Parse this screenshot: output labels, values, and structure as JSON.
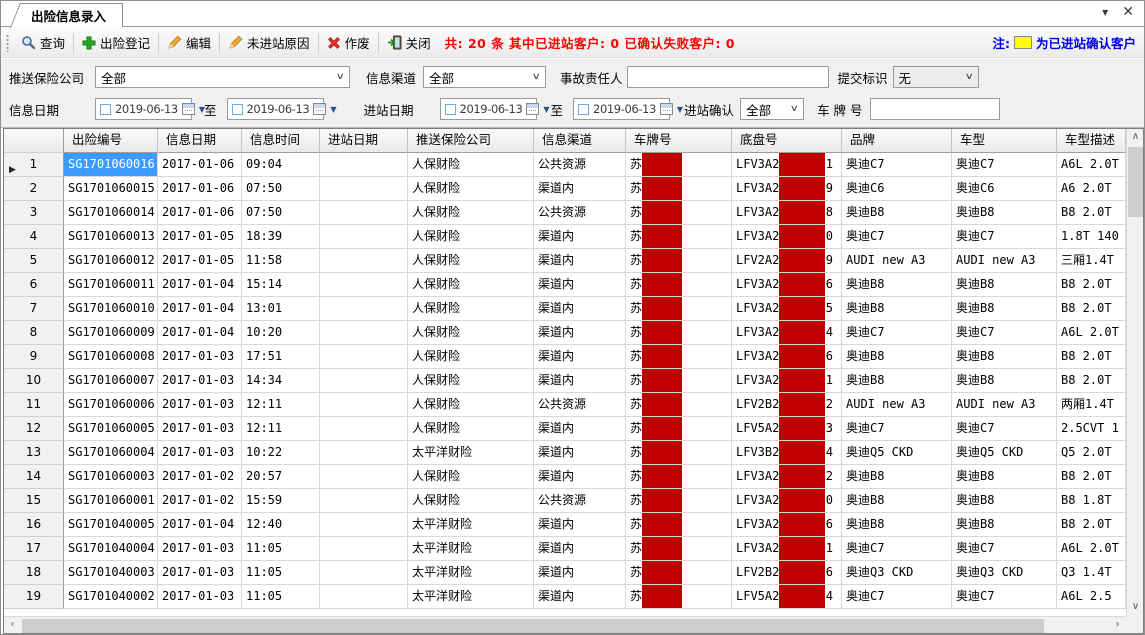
{
  "window": {
    "tab_title": "出险信息录入",
    "dropdown_glyph": "▼",
    "close_glyph": "✕"
  },
  "toolbar": {
    "buttons": [
      {
        "name": "query-button",
        "icon": "search-icon",
        "label": "查询"
      },
      {
        "name": "claim-register-button",
        "icon": "plus-icon",
        "label": "出险登记"
      },
      {
        "name": "edit-button",
        "icon": "pencil-icon",
        "label": "编辑"
      },
      {
        "name": "no-entry-reason-button",
        "icon": "pencil-icon",
        "label": "未进站原因"
      },
      {
        "name": "void-button",
        "icon": "void-x-icon",
        "label": "作废"
      },
      {
        "name": "close-button",
        "icon": "close-exit-icon",
        "label": "关闭"
      }
    ],
    "summary": "共:  20 条  其中已进站客户: 0  已确认失败客户: 0",
    "note_prefix": "注:",
    "note_swatch_color": "#ffff00",
    "note_suffix": "为已进站确认客户"
  },
  "filters": {
    "insurer_label": "推送保险公司",
    "insurer_value": "全部",
    "channel_label": "信息渠道",
    "channel_value": "全部",
    "responsible_label": "事故责任人",
    "responsible_value": "",
    "submit_flag_label": "提交标识",
    "submit_flag_value": "无",
    "info_date_label": "信息日期",
    "info_date_from": "2019-06-13",
    "to_label_1": "至",
    "info_date_to": "2019-06-13",
    "station_date_label": "进站日期",
    "station_date_from": "2019-06-13",
    "to_label_2": "至",
    "station_date_to": "2019-06-13",
    "station_confirm_label": "进站确认",
    "station_confirm_value": "全部",
    "plate_label": "车 牌 号",
    "plate_value": ""
  },
  "grid": {
    "columns": [
      "出险编号",
      "信息日期",
      "信息时间",
      "进站日期",
      "推送保险公司",
      "信息渠道",
      "车牌号",
      "底盘号",
      "品牌",
      "车型",
      "车型描述"
    ],
    "redaction_color": "#c00000",
    "selection_color": "#3d9bff",
    "rows": [
      {
        "num": "1",
        "claim_no": "SG1701060016",
        "info_date": "2017-01-06",
        "info_time": "09:04",
        "station_date": "",
        "insurer": "人保财险",
        "channel": "公共资源",
        "plate_prefix": "苏",
        "chassis_prefix": "LFV3A2",
        "chassis_suffix": "1",
        "brand": "奥迪C7",
        "model": "奥迪C7",
        "desc": "A6L 2.0T",
        "selected": true
      },
      {
        "num": "2",
        "claim_no": "SG1701060015",
        "info_date": "2017-01-06",
        "info_time": "07:50",
        "station_date": "",
        "insurer": "人保财险",
        "channel": "渠道内",
        "plate_prefix": "苏",
        "chassis_prefix": "LFV3A2",
        "chassis_suffix": "9",
        "brand": "奥迪C6",
        "model": "奥迪C6",
        "desc": "A6 2.0T",
        "selected": false
      },
      {
        "num": "3",
        "claim_no": "SG1701060014",
        "info_date": "2017-01-06",
        "info_time": "07:50",
        "station_date": "",
        "insurer": "人保财险",
        "channel": "公共资源",
        "plate_prefix": "苏",
        "chassis_prefix": "LFV3A2",
        "chassis_suffix": "8",
        "brand": "奥迪B8",
        "model": "奥迪B8",
        "desc": "B8 2.0T",
        "selected": false
      },
      {
        "num": "4",
        "claim_no": "SG1701060013",
        "info_date": "2017-01-05",
        "info_time": "18:39",
        "station_date": "",
        "insurer": "人保财险",
        "channel": "渠道内",
        "plate_prefix": "苏",
        "chassis_prefix": "LFV3A2",
        "chassis_suffix": "0",
        "brand": "奥迪C7",
        "model": "奥迪C7",
        "desc": "1.8T 140",
        "selected": false
      },
      {
        "num": "5",
        "claim_no": "SG1701060012",
        "info_date": "2017-01-05",
        "info_time": "11:58",
        "station_date": "",
        "insurer": "人保财险",
        "channel": "渠道内",
        "plate_prefix": "苏",
        "chassis_prefix": "LFV2A2",
        "chassis_suffix": "9",
        "brand": "AUDI new A3",
        "model": "AUDI new A3",
        "desc": "三厢1.4T",
        "selected": false
      },
      {
        "num": "6",
        "claim_no": "SG1701060011",
        "info_date": "2017-01-04",
        "info_time": "15:14",
        "station_date": "",
        "insurer": "人保财险",
        "channel": "渠道内",
        "plate_prefix": "苏",
        "chassis_prefix": "LFV3A2",
        "chassis_suffix": "6",
        "brand": "奥迪B8",
        "model": "奥迪B8",
        "desc": "B8 2.0T",
        "selected": false
      },
      {
        "num": "7",
        "claim_no": "SG1701060010",
        "info_date": "2017-01-04",
        "info_time": "13:01",
        "station_date": "",
        "insurer": "人保财险",
        "channel": "渠道内",
        "plate_prefix": "苏",
        "chassis_prefix": "LFV3A2",
        "chassis_suffix": "5",
        "brand": "奥迪B8",
        "model": "奥迪B8",
        "desc": "B8 2.0T",
        "selected": false
      },
      {
        "num": "8",
        "claim_no": "SG1701060009",
        "info_date": "2017-01-04",
        "info_time": "10:20",
        "station_date": "",
        "insurer": "人保财险",
        "channel": "渠道内",
        "plate_prefix": "苏",
        "chassis_prefix": "LFV3A2",
        "chassis_suffix": "4",
        "brand": "奥迪C7",
        "model": "奥迪C7",
        "desc": "A6L 2.0T",
        "selected": false
      },
      {
        "num": "9",
        "claim_no": "SG1701060008",
        "info_date": "2017-01-03",
        "info_time": "17:51",
        "station_date": "",
        "insurer": "人保财险",
        "channel": "渠道内",
        "plate_prefix": "苏",
        "chassis_prefix": "LFV3A2",
        "chassis_suffix": "6",
        "brand": "奥迪B8",
        "model": "奥迪B8",
        "desc": "B8 2.0T",
        "selected": false
      },
      {
        "num": "10",
        "claim_no": "SG1701060007",
        "info_date": "2017-01-03",
        "info_time": "14:34",
        "station_date": "",
        "insurer": "人保财险",
        "channel": "渠道内",
        "plate_prefix": "苏",
        "chassis_prefix": "LFV3A2",
        "chassis_suffix": "1",
        "brand": "奥迪B8",
        "model": "奥迪B8",
        "desc": "B8 2.0T",
        "selected": false
      },
      {
        "num": "11",
        "claim_no": "SG1701060006",
        "info_date": "2017-01-03",
        "info_time": "12:11",
        "station_date": "",
        "insurer": "人保财险",
        "channel": "公共资源",
        "plate_prefix": "苏",
        "chassis_prefix": "LFV2B2",
        "chassis_suffix": "2",
        "brand": "AUDI new A3",
        "model": "AUDI new A3",
        "desc": "两厢1.4T",
        "selected": false
      },
      {
        "num": "12",
        "claim_no": "SG1701060005",
        "info_date": "2017-01-03",
        "info_time": "12:11",
        "station_date": "",
        "insurer": "人保财险",
        "channel": "渠道内",
        "plate_prefix": "苏",
        "chassis_prefix": "LFV5A2",
        "chassis_suffix": "3",
        "brand": "奥迪C7",
        "model": "奥迪C7",
        "desc": "2.5CVT 1",
        "selected": false
      },
      {
        "num": "13",
        "claim_no": "SG1701060004",
        "info_date": "2017-01-03",
        "info_time": "10:22",
        "station_date": "",
        "insurer": "太平洋财险",
        "channel": "渠道内",
        "plate_prefix": "苏",
        "chassis_prefix": "LFV3B2",
        "chassis_suffix": "4",
        "brand": "奥迪Q5 CKD",
        "model": "奥迪Q5 CKD",
        "desc": "Q5 2.0T",
        "selected": false
      },
      {
        "num": "14",
        "claim_no": "SG1701060003",
        "info_date": "2017-01-02",
        "info_time": "20:57",
        "station_date": "",
        "insurer": "人保财险",
        "channel": "渠道内",
        "plate_prefix": "苏",
        "chassis_prefix": "LFV3A2",
        "chassis_suffix": "2",
        "brand": "奥迪B8",
        "model": "奥迪B8",
        "desc": "B8 2.0T",
        "selected": false
      },
      {
        "num": "15",
        "claim_no": "SG1701060001",
        "info_date": "2017-01-02",
        "info_time": "15:59",
        "station_date": "",
        "insurer": "人保财险",
        "channel": "公共资源",
        "plate_prefix": "苏",
        "chassis_prefix": "LFV3A2",
        "chassis_suffix": "0",
        "brand": "奥迪B8",
        "model": "奥迪B8",
        "desc": "B8 1.8T",
        "selected": false
      },
      {
        "num": "16",
        "claim_no": "SG1701040005",
        "info_date": "2017-01-04",
        "info_time": "12:40",
        "station_date": "",
        "insurer": "太平洋财险",
        "channel": "渠道内",
        "plate_prefix": "苏",
        "chassis_prefix": "LFV3A2",
        "chassis_suffix": "6",
        "brand": "奥迪B8",
        "model": "奥迪B8",
        "desc": "B8 2.0T",
        "selected": false
      },
      {
        "num": "17",
        "claim_no": "SG1701040004",
        "info_date": "2017-01-03",
        "info_time": "11:05",
        "station_date": "",
        "insurer": "太平洋财险",
        "channel": "渠道内",
        "plate_prefix": "苏",
        "chassis_prefix": "LFV3A2",
        "chassis_suffix": "1",
        "brand": "奥迪C7",
        "model": "奥迪C7",
        "desc": "A6L 2.0T",
        "selected": false
      },
      {
        "num": "18",
        "claim_no": "SG1701040003",
        "info_date": "2017-01-03",
        "info_time": "11:05",
        "station_date": "",
        "insurer": "太平洋财险",
        "channel": "渠道内",
        "plate_prefix": "苏",
        "chassis_prefix": "LFV2B2",
        "chassis_suffix": "6",
        "brand": "奥迪Q3 CKD",
        "model": "奥迪Q3 CKD",
        "desc": "Q3 1.4T",
        "selected": false
      },
      {
        "num": "19",
        "claim_no": "SG1701040002",
        "info_date": "2017-01-03",
        "info_time": "11:05",
        "station_date": "",
        "insurer": "太平洋财险",
        "channel": "渠道内",
        "plate_prefix": "苏",
        "chassis_prefix": "LFV5A2",
        "chassis_suffix": "4",
        "brand": "奥迪C7",
        "model": "奥迪C7",
        "desc": "A6L 2.5",
        "selected": false
      }
    ]
  }
}
